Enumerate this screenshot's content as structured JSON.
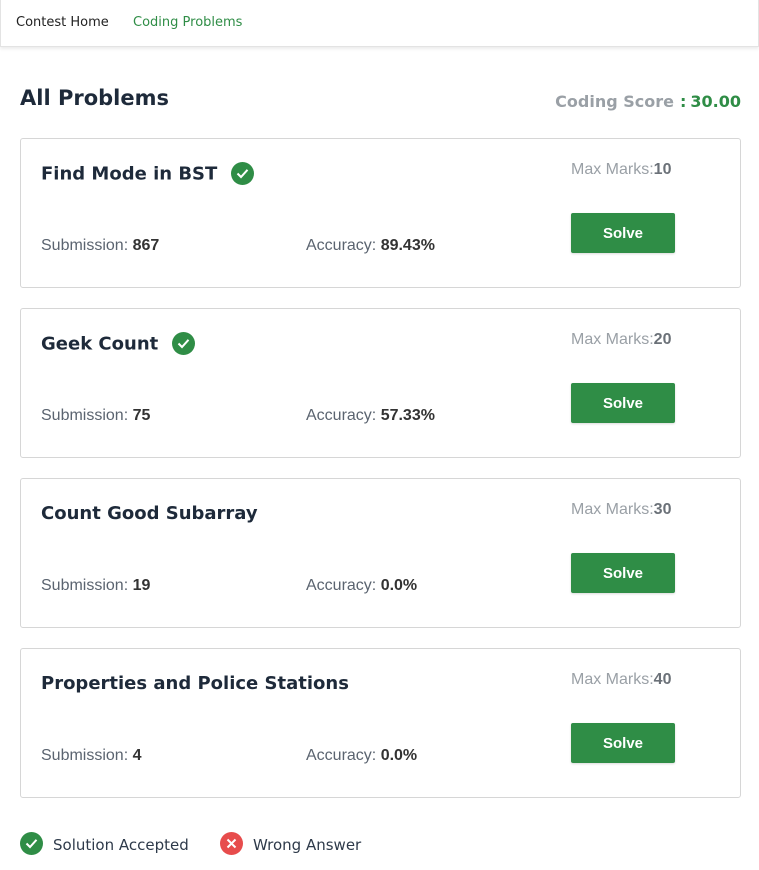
{
  "nav": {
    "items": [
      {
        "label": "Contest Home"
      },
      {
        "label": "Coding Problems"
      }
    ]
  },
  "page": {
    "title": "All Problems",
    "score_label": "Coding Score",
    "score_sep": ":",
    "score_value": "30.00"
  },
  "labels": {
    "submission": "Submission: ",
    "accuracy": "Accuracy: ",
    "max_marks": "Max Marks:",
    "solve": "Solve"
  },
  "problems": [
    {
      "title": "Find Mode in BST",
      "accepted": true,
      "submissions": "867",
      "accuracy": "89.43%",
      "max_marks": "10"
    },
    {
      "title": "Geek Count",
      "accepted": true,
      "submissions": "75",
      "accuracy": "57.33%",
      "max_marks": "20"
    },
    {
      "title": "Count Good Subarray",
      "accepted": false,
      "submissions": "19",
      "accuracy": "0.0%",
      "max_marks": "30"
    },
    {
      "title": "Properties and Police Stations",
      "accepted": false,
      "submissions": "4",
      "accuracy": "0.0%",
      "max_marks": "40"
    }
  ],
  "legend": {
    "accepted": {
      "label": "Solution Accepted",
      "icon": "check-circle-icon",
      "color": "#2f8d46"
    },
    "wrong": {
      "label": "Wrong Answer",
      "icon": "x-circle-icon",
      "color": "#e74c4c"
    }
  },
  "colors": {
    "accent": "#2f8d46",
    "title": "#1e2a3a",
    "muted": "#9aa0a6"
  }
}
